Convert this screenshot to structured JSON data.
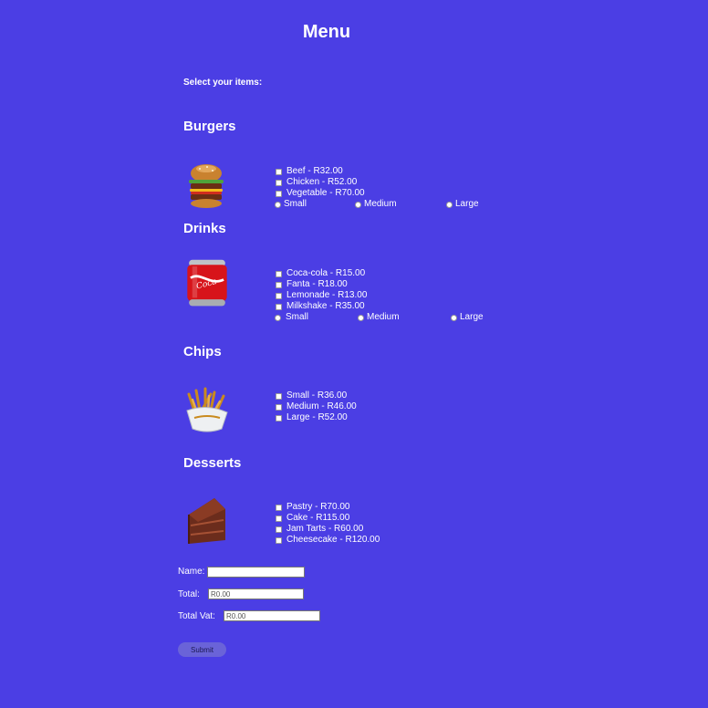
{
  "page_title": "Menu",
  "subtitle": "Select your items:",
  "burgers": {
    "title": "Burgers",
    "image_icon": "burger-icon",
    "items": [
      "Beef - R32.00",
      "Chicken - R52.00",
      "Vegetable - R70.00"
    ],
    "sizes": [
      "Small",
      "Medium",
      "Large"
    ]
  },
  "drinks": {
    "title": "Drinks",
    "image_icon": "soda-can-icon",
    "items": [
      "Coca-cola - R15.00",
      "Fanta - R18.00",
      "Lemonade - R13.00",
      "Milkshake - R35.00"
    ],
    "sizes": [
      "Small",
      "Medium",
      "Large"
    ]
  },
  "chips": {
    "title": "Chips",
    "image_icon": "fries-icon",
    "items": [
      "Small - R36.00",
      "Medium - R46.00",
      "Large - R52.00"
    ]
  },
  "desserts": {
    "title": "Desserts",
    "image_icon": "cake-slice-icon",
    "items": [
      "Pastry - R70.00",
      "Cake - R115.00",
      "Jam Tarts - R60.00",
      "Cheesecake - R120.00"
    ]
  },
  "form": {
    "name_label": "Name:",
    "name_value": "",
    "total_label": "Total:",
    "total_value": "R0.00",
    "vat_label": "Total Vat:",
    "vat_value": "R0.00",
    "submit_label": "Submit"
  },
  "colors": {
    "background": "#4b3ee4",
    "text": "#ffffff",
    "submit_bg": "#6a63d8"
  }
}
